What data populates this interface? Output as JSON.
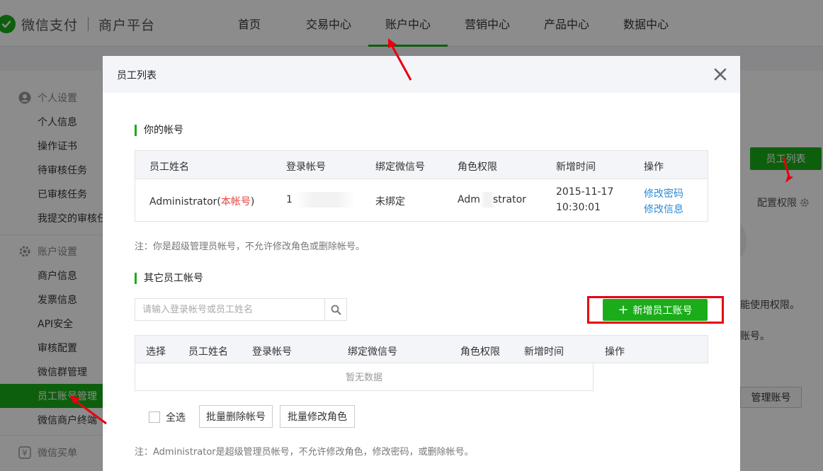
{
  "header": {
    "brand": "微信支付",
    "sub": "商户平台",
    "nav": [
      {
        "label": "首页"
      },
      {
        "label": "交易中心"
      },
      {
        "label": "账户中心"
      },
      {
        "label": "营销中心"
      },
      {
        "label": "产品中心"
      },
      {
        "label": "数据中心"
      }
    ],
    "active_nav": "账户中心"
  },
  "sidebar": {
    "group1": {
      "title": "个人设置",
      "icon": "person-icon"
    },
    "group1_items": [
      {
        "label": "个人信息"
      },
      {
        "label": "操作证书"
      },
      {
        "label": "待审核任务"
      },
      {
        "label": "已审核任务"
      },
      {
        "label": "我提交的审核任"
      }
    ],
    "group2": {
      "title": "账户设置",
      "icon": "gear-icon"
    },
    "group2_items": [
      {
        "label": "商户信息"
      },
      {
        "label": "发票信息"
      },
      {
        "label": "API安全"
      },
      {
        "label": "审核配置"
      },
      {
        "label": "微信群管理"
      },
      {
        "label": "员工账号管理"
      },
      {
        "label": "微信商户终端"
      }
    ],
    "group3": {
      "title": "微信买单",
      "icon": "yen-icon"
    }
  },
  "background": {
    "staff_list_button": "员工列表",
    "config_label": "配置权限",
    "text1": "能使用权限。",
    "text2": "账号。",
    "manage_button": "管理账号"
  },
  "modal": {
    "title": "员工列表",
    "section_mine": "你的帐号",
    "mine_table": {
      "headers": [
        "员工姓名",
        "登录帐号",
        "绑定微信号",
        "角色权限",
        "新增时间",
        "操作"
      ],
      "row": {
        "name": "Administrator(",
        "name_tag": "本帐号",
        "name_close": ")",
        "login": "1",
        "wechat": "未绑定",
        "role_a": "Admi",
        "role_b": "strator",
        "date": "2015-11-17",
        "time": "10:30:01",
        "action1": "修改密码",
        "action2": "修改信息"
      }
    },
    "note_mine": "注：你是超级管理员帐号，不允许修改角色或删除帐号。",
    "section_other": "其它员工帐号",
    "search_placeholder": "请输入登录帐号或员工姓名",
    "add_button": "新增员工账号",
    "other_table": {
      "headers": [
        "选择",
        "员工姓名",
        "登录帐号",
        "绑定微信号",
        "角色权限",
        "新增时间",
        "操作"
      ],
      "empty": "暂无数据"
    },
    "select_all": "全选",
    "batch_delete": "批量删除帐号",
    "batch_role": "批量修改角色",
    "note_other": "注：Administrator是超级管理员帐号，不允许修改角色，修改密码，或删除帐号。"
  },
  "colors": {
    "accent": "#1aad19",
    "link": "#2b8bd6",
    "highlight": "#e60012"
  }
}
